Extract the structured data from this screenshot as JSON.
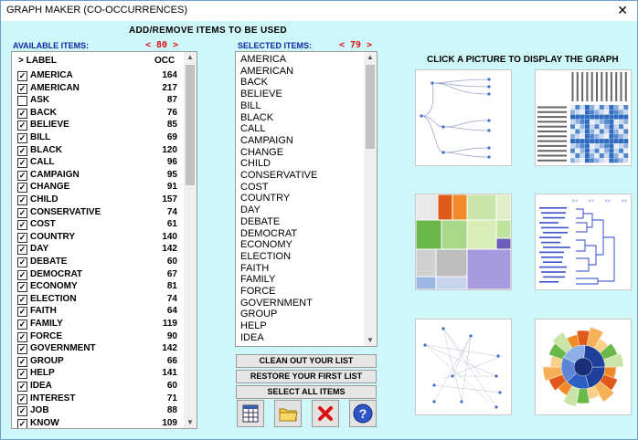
{
  "window": {
    "title": "GRAPH MAKER (CO-OCCURRENCES)",
    "close_glyph": "✕"
  },
  "heading_add": "ADD/REMOVE ITEMS TO BE USED",
  "available": {
    "label": "AVAILABLE ITEMS:",
    "count": "< 80 >",
    "col_label": "> LABEL",
    "col_occ": "OCC",
    "items": [
      {
        "label": "AMERICA",
        "occ": "164",
        "checked": true
      },
      {
        "label": "AMERICAN",
        "occ": "217",
        "checked": true
      },
      {
        "label": "ASK",
        "occ": "87",
        "checked": false
      },
      {
        "label": "BACK",
        "occ": "76",
        "checked": true
      },
      {
        "label": "BELIEVE",
        "occ": "85",
        "checked": true
      },
      {
        "label": "BILL",
        "occ": "69",
        "checked": true
      },
      {
        "label": "BLACK",
        "occ": "120",
        "checked": true
      },
      {
        "label": "CALL",
        "occ": "96",
        "checked": true
      },
      {
        "label": "CAMPAIGN",
        "occ": "95",
        "checked": true
      },
      {
        "label": "CHANGE",
        "occ": "91",
        "checked": true
      },
      {
        "label": "CHILD",
        "occ": "157",
        "checked": true
      },
      {
        "label": "CONSERVATIVE",
        "occ": "74",
        "checked": true
      },
      {
        "label": "COST",
        "occ": "61",
        "checked": true
      },
      {
        "label": "COUNTRY",
        "occ": "140",
        "checked": true
      },
      {
        "label": "DAY",
        "occ": "142",
        "checked": true
      },
      {
        "label": "DEBATE",
        "occ": "60",
        "checked": true
      },
      {
        "label": "DEMOCRAT",
        "occ": "67",
        "checked": true
      },
      {
        "label": "ECONOMY",
        "occ": "81",
        "checked": true
      },
      {
        "label": "ELECTION",
        "occ": "74",
        "checked": true
      },
      {
        "label": "FAITH",
        "occ": "64",
        "checked": true
      },
      {
        "label": "FAMILY",
        "occ": "119",
        "checked": true
      },
      {
        "label": "FORCE",
        "occ": "90",
        "checked": true
      },
      {
        "label": "GOVERNMENT",
        "occ": "142",
        "checked": true
      },
      {
        "label": "GROUP",
        "occ": "66",
        "checked": true
      },
      {
        "label": "HELP",
        "occ": "141",
        "checked": true
      },
      {
        "label": "IDEA",
        "occ": "60",
        "checked": true
      },
      {
        "label": "INTEREST",
        "occ": "71",
        "checked": true
      },
      {
        "label": "JOB",
        "occ": "88",
        "checked": true
      },
      {
        "label": "KNOW",
        "occ": "109",
        "checked": true
      }
    ]
  },
  "selected": {
    "label": "SELECTED ITEMS:",
    "count": "< 79 >",
    "items": [
      "AMERICA",
      "AMERICAN",
      "BACK",
      "BELIEVE",
      "BILL",
      "BLACK",
      "CALL",
      "CAMPAIGN",
      "CHANGE",
      "CHILD",
      "CONSERVATIVE",
      "COST",
      "COUNTRY",
      "DAY",
      "DEBATE",
      "DEMOCRAT",
      "ECONOMY",
      "ELECTION",
      "FAITH",
      "FAMILY",
      "FORCE",
      "GOVERNMENT",
      "GROUP",
      "HELP",
      "IDEA"
    ]
  },
  "buttons": {
    "clean": "CLEAN OUT YOUR LIST",
    "restore": "RESTORE YOUR FIRST LIST",
    "select_all": "SELECT ALL ITEMS"
  },
  "toolbar_icons": [
    "table-icon",
    "folder-icon",
    "delete-icon",
    "help-icon"
  ],
  "heading_click": "CLICK A PICTURE TO DISPLAY THE GRAPH",
  "previews": [
    {
      "name": "tree-graph-preview"
    },
    {
      "name": "heatmap-preview"
    },
    {
      "name": "treemap-preview"
    },
    {
      "name": "dendrogram-preview"
    },
    {
      "name": "network-preview"
    },
    {
      "name": "sunburst-preview"
    }
  ]
}
